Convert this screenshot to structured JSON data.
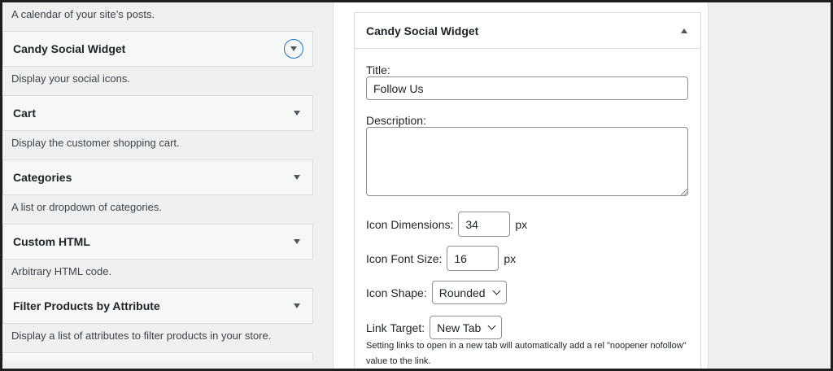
{
  "left_list": {
    "top_description": "A calendar of your site’s posts.",
    "widgets": [
      {
        "title": "Candy Social Widget",
        "description": "Display your social icons."
      },
      {
        "title": "Cart",
        "description": "Display the customer shopping cart."
      },
      {
        "title": "Categories",
        "description": "A list or dropdown of categories."
      },
      {
        "title": "Custom HTML",
        "description": "Arbitrary HTML code."
      },
      {
        "title": "Filter Products by Attribute",
        "description": "Display a list of attributes to filter products in your store."
      }
    ]
  },
  "panel": {
    "title": "Candy Social Widget",
    "title_label": "Title:",
    "title_value": "Follow Us",
    "description_label": "Description:",
    "description_value": "",
    "icon_dimensions_label": "Icon Dimensions:",
    "icon_dimensions_value": "34",
    "icon_font_size_label": "Icon Font Size:",
    "icon_font_size_value": "16",
    "unit_px": "px",
    "icon_shape_label": "Icon Shape:",
    "icon_shape_value": "Rounded",
    "link_target_label": "Link Target:",
    "link_target_value": "New Tab",
    "help_text": "Setting links to open in a new tab will automatically add a rel \"noopener nofollow\" value to the link."
  },
  "colors": {
    "accent": "#2271b1",
    "border": "#dcdcde",
    "bg": "#f0f0f1"
  }
}
